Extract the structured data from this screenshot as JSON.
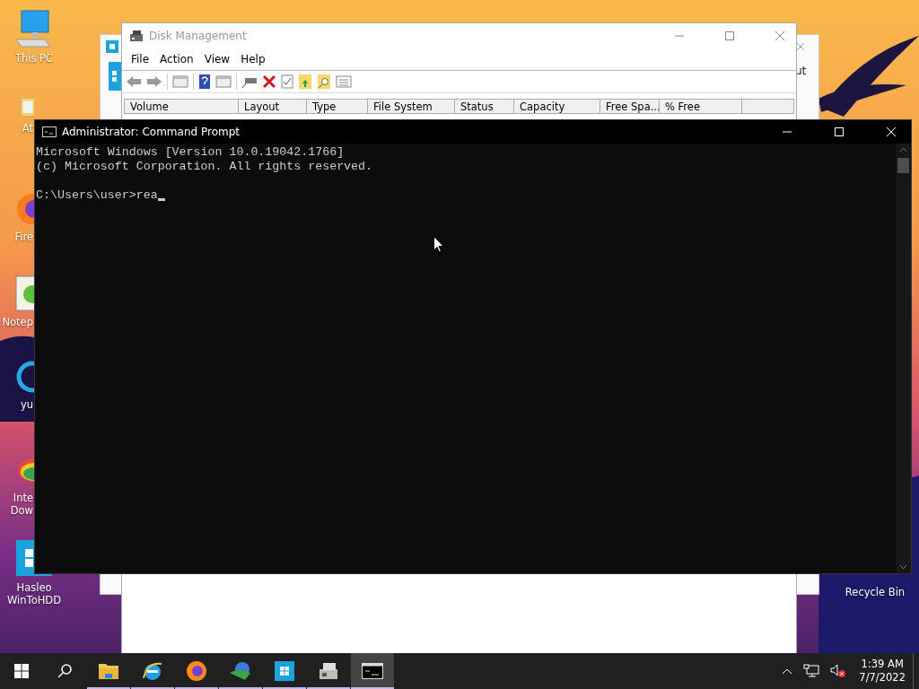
{
  "desktop_icons": [
    {
      "kind": "computer",
      "lines": [
        "This PC"
      ]
    },
    {
      "kind": "document",
      "lines": [
        "At"
      ]
    },
    {
      "kind": "browser",
      "lines": [
        "Fire"
      ]
    },
    {
      "kind": "notepad",
      "lines": [
        "Notep"
      ]
    },
    {
      "kind": "ring",
      "lines": [
        "yu"
      ]
    },
    {
      "kind": "globe",
      "lines": [
        "Inte",
        "Dow"
      ]
    },
    {
      "kind": "tile",
      "lines": [
        "Hasleo",
        "WinToHDD"
      ]
    },
    {
      "kind": "bin",
      "lines": [
        "Recycle Bin"
      ]
    }
  ],
  "back_window": {
    "text": "ut"
  },
  "disk_management": {
    "title": "Disk Management",
    "menu": [
      "File",
      "Action",
      "View",
      "Help"
    ],
    "columns": [
      "Volume",
      "Layout",
      "Type",
      "File System",
      "Status",
      "Capacity",
      "Free Spa...",
      "% Free",
      ""
    ]
  },
  "command_prompt": {
    "title": "Administrator: Command Prompt",
    "lines": [
      "Microsoft Windows [Version 10.0.19042.1766]",
      "(c) Microsoft Corporation. All rights reserved."
    ],
    "prompt": "C:\\Users\\user>rea"
  },
  "taskbar": {
    "apps": [
      {
        "kind": "folder",
        "running": true,
        "selected": false
      },
      {
        "kind": "ie",
        "running": true,
        "selected": false
      },
      {
        "kind": "firefox",
        "running": true,
        "selected": false
      },
      {
        "kind": "idm",
        "running": true,
        "selected": false
      },
      {
        "kind": "hasleo",
        "running": true,
        "selected": false
      },
      {
        "kind": "disk",
        "running": true,
        "selected": false
      },
      {
        "kind": "cmd",
        "running": true,
        "selected": true
      }
    ],
    "time": "1:39 AM",
    "date": "7/7/2022"
  }
}
